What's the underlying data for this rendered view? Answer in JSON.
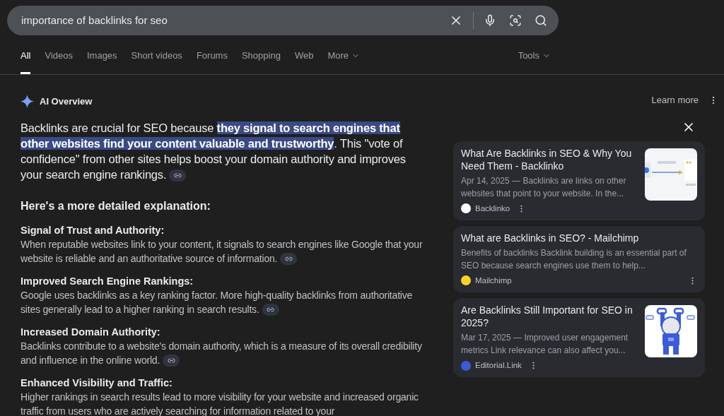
{
  "search": {
    "value": "importance of backlinks for seo"
  },
  "tabs": [
    {
      "label": "All",
      "selected": true
    },
    {
      "label": "Videos",
      "selected": false
    },
    {
      "label": "Images",
      "selected": false
    },
    {
      "label": "Short videos",
      "selected": false
    },
    {
      "label": "Forums",
      "selected": false
    },
    {
      "label": "Shopping",
      "selected": false
    },
    {
      "label": "Web",
      "selected": false
    },
    {
      "label": "More",
      "selected": false,
      "kind": "dropdown"
    }
  ],
  "tools": "Tools",
  "ai_overview": {
    "title": "AI Overview",
    "learn_more": "Learn more",
    "summary": {
      "before": "Backlinks are crucial for SEO because ",
      "highlight": "they signal to search engines that other websites find your content valuable and trustworthy",
      "after": ". This \"vote of confidence\" from other sites helps boost your domain authority and improves your search engine rankings."
    },
    "subheading": "Here's a more detailed explanation:",
    "points": [
      {
        "title": "Signal of Trust and Authority:",
        "text": "When reputable websites link to your content, it signals to search engines like Google that your website is reliable and an authoritative source of information.",
        "link": true
      },
      {
        "title": "Improved Search Engine Rankings:",
        "text": "Google uses backlinks as a key ranking factor. More high-quality backlinks from authoritative sites generally lead to a higher ranking in search results.",
        "link": true
      },
      {
        "title": "Increased Domain Authority:",
        "text": "Backlinks contribute to a website's domain authority, which is a measure of its overall credibility and influence in the online world.",
        "link": true
      },
      {
        "title": "Enhanced Visibility and Traffic:",
        "text": "Higher rankings in search results lead to more visibility for your website and increased organic traffic from users who are actively searching for information related to your",
        "link": false
      }
    ]
  },
  "sources": [
    {
      "title": "What Are Backlinks in SEO & Why You Need Them - Backlinko",
      "snippet": "Apr 14, 2025 — Backlinks are links on other websites that point to your website. In the...",
      "site": "Backlinko",
      "color": "#ffffff"
    },
    {
      "title": "What are Backlinks in SEO? - Mailchimp",
      "snippet": "Benefits of backlinks Backlink building is an essential part of SEO because search engines use them to help...",
      "site": "Mailchimp",
      "color": "#f5d327"
    },
    {
      "title": "Are Backlinks Still Important for SEO in 2025?",
      "snippet": "Mar 17, 2025 — Improved user engagement metrics Link relevance can also affect you...",
      "site": "Editorial.Link",
      "color": "#3b5bdb"
    }
  ]
}
